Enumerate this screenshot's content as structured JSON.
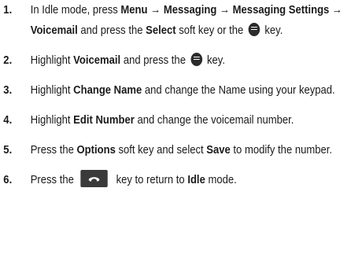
{
  "steps": [
    {
      "num": "1.",
      "parts": {
        "a": "In Idle mode, press ",
        "b": "Menu → Messaging → Messaging Settings → Voicemail",
        "c": " and press the ",
        "d": "Select",
        "e": " soft key or the ",
        "f": " key."
      }
    },
    {
      "num": "2.",
      "parts": {
        "a": "Highlight ",
        "b": "Voicemail",
        "c": " and press the ",
        "d": " key."
      }
    },
    {
      "num": "3.",
      "parts": {
        "a": "Highlight ",
        "b": "Change Name",
        "c": " and change the Name using your keypad."
      }
    },
    {
      "num": "4.",
      "parts": {
        "a": "Highlight ",
        "b": "Edit Number",
        "c": " and change the voicemail number."
      }
    },
    {
      "num": "5.",
      "parts": {
        "a": "Press the ",
        "b": "Options",
        "c": " soft key and select ",
        "d": "Save",
        "e": " to modify the number."
      }
    },
    {
      "num": "6.",
      "parts": {
        "a": "Press the ",
        "b": " key to return to ",
        "c": "Idle",
        "d": " mode."
      }
    }
  ],
  "icons": {
    "ok_key": "ok-key-icon",
    "end_key": "end-key-icon"
  }
}
